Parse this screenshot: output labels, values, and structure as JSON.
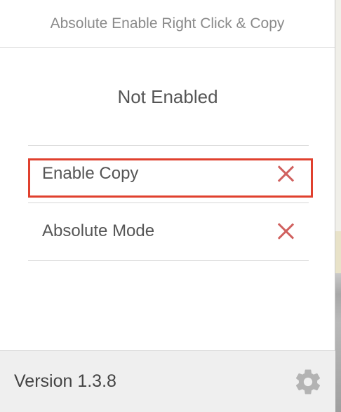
{
  "header": {
    "title": "Absolute Enable Right Click & Copy"
  },
  "status": {
    "text": "Not Enabled"
  },
  "options": [
    {
      "label": "Enable Copy",
      "state_icon": "close-icon",
      "highlighted": true
    },
    {
      "label": "Absolute Mode",
      "state_icon": "close-icon",
      "highlighted": false
    }
  ],
  "footer": {
    "version": "Version 1.3.8",
    "settings_icon": "gear-icon"
  },
  "colors": {
    "x_icon": "#d0605e",
    "highlight_border": "#e0402e",
    "footer_bg": "#efefef",
    "text": "#555555"
  }
}
